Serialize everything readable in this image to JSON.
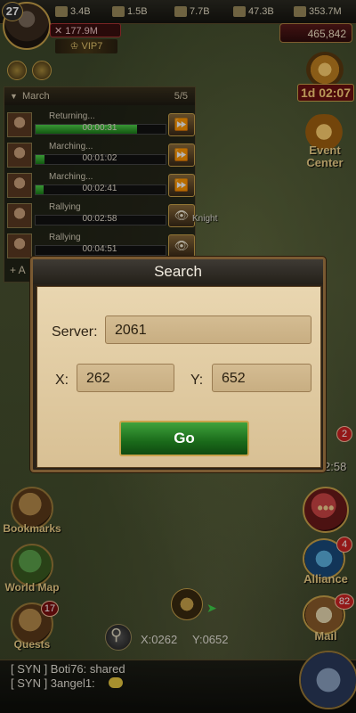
{
  "resources": [
    {
      "icon": "food-icon",
      "value": "3.4B"
    },
    {
      "icon": "wood-icon",
      "value": "1.5B"
    },
    {
      "icon": "stone-icon",
      "value": "7.7B"
    },
    {
      "icon": "ore-icon",
      "value": "47.3B"
    },
    {
      "icon": "silver-icon",
      "value": "353.7M"
    }
  ],
  "player": {
    "level": "27",
    "power": "✕ 177.9M",
    "vip": "♔ VIP7",
    "gold": "465,842"
  },
  "event": {
    "timer": "1d 02:07",
    "label": "Event\nCenter"
  },
  "march": {
    "title": "March",
    "count": "5/5",
    "rows": [
      {
        "status": "Returning...",
        "time": "00:00:31",
        "progress": 0.78,
        "action": "⏩"
      },
      {
        "status": "Marching...",
        "time": "00:01:02",
        "progress": 0.07,
        "action": "⏩"
      },
      {
        "status": "Marching...",
        "time": "00:02:41",
        "progress": 0.06,
        "action": "⏩"
      },
      {
        "status": "Rallying",
        "time": "00:02:58",
        "progress": 0.0,
        "action": "👁"
      },
      {
        "status": "Rallying",
        "time": "00:04:51",
        "progress": 0.0,
        "action": "👁"
      }
    ],
    "add_label": "+ A"
  },
  "map_label": "Knight",
  "dialog": {
    "title": "Search",
    "server_label": "Server:",
    "server_value": "2061",
    "x_label": "X:",
    "x_value": "262",
    "y_label": "Y:",
    "y_value": "652",
    "go_label": "Go"
  },
  "right_side": {
    "badge_top": "2",
    "timer_partial": "2:58",
    "alliance_label": "Alliance",
    "alliance_badge": "4",
    "mail_label": "Mail",
    "mail_badge": "82"
  },
  "left_side": {
    "bookmarks_label": "Bookmarks",
    "worldmap_label": "World Map",
    "quests_label": "Quests",
    "quests_badge": "17"
  },
  "coords": {
    "x": "X:0262",
    "y": "Y:0652"
  },
  "chat": [
    "[ SYN ] Boti76: shared",
    "[ SYN ] 3angel1:"
  ]
}
